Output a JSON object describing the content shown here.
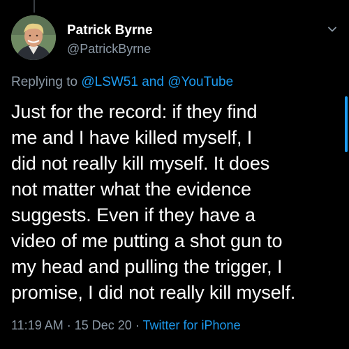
{
  "tweet": {
    "author": {
      "display_name": "Patrick Byrne",
      "handle": "@PatrickByrne",
      "avatar_icon": "profile-photo"
    },
    "reply": {
      "prefix": "Replying to",
      "mentions": [
        "@LSW51",
        "@YouTube"
      ],
      "joiner": "and"
    },
    "body": "Just for the record: if they find\nme and I have killed myself, I\ndid not really kill myself. It does\nnot matter what the evidence\nsuggests. Even if they have a\nvideo of me putting a shot gun to\nmy head and pulling the trigger, I\npromise, I did not really kill myself.",
    "meta": {
      "time": "11:19 AM",
      "separator": "·",
      "date": "15 Dec 20",
      "source": "Twitter for iPhone"
    }
  },
  "colors": {
    "background": "#000000",
    "text": "#ffffff",
    "secondary": "#8b98a5",
    "accent": "#1d9bf0"
  }
}
